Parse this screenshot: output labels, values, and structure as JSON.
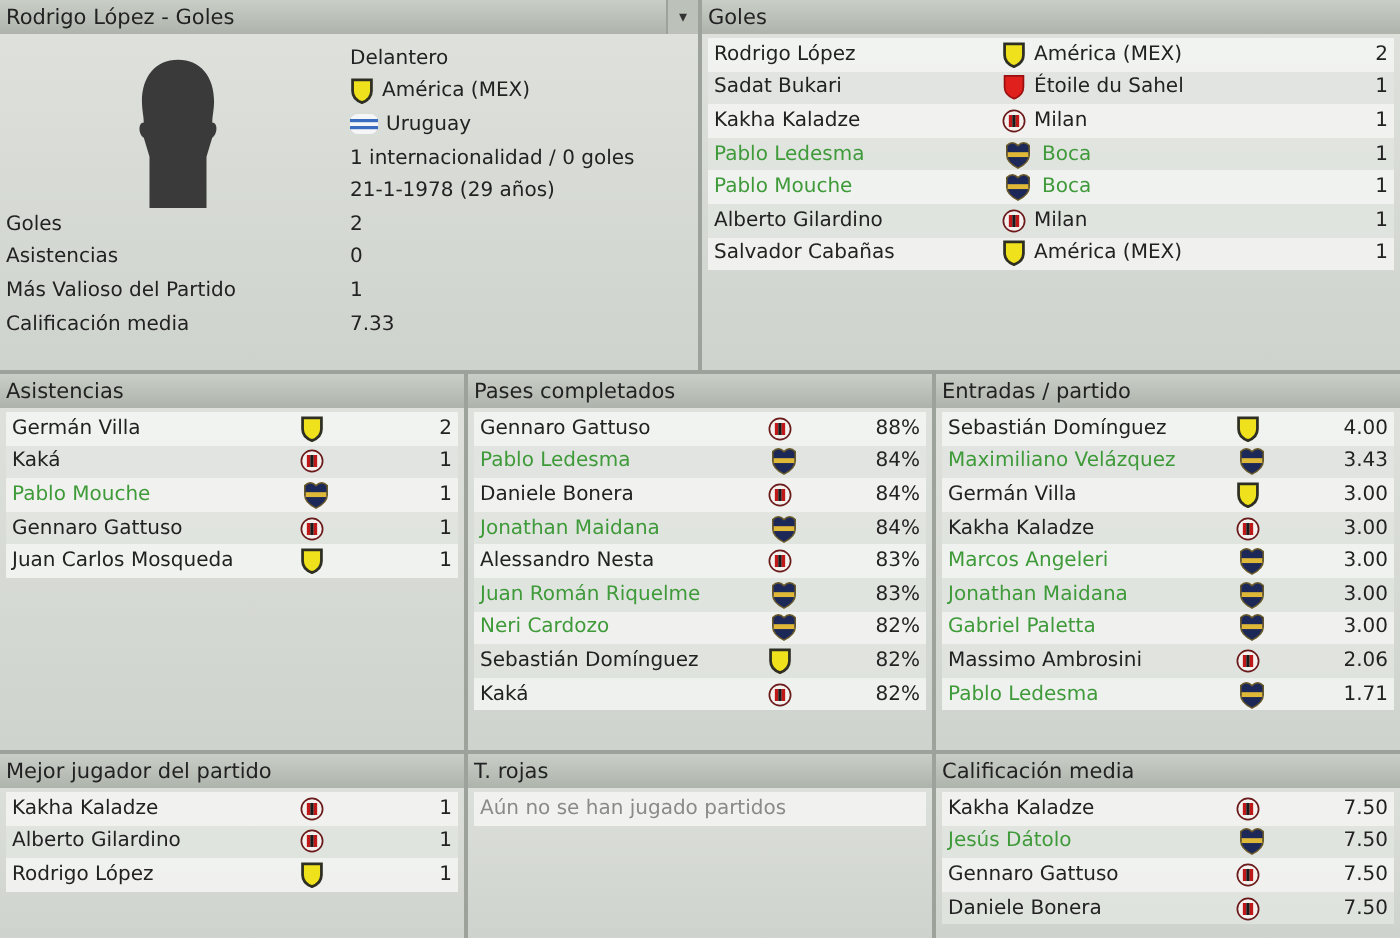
{
  "profile": {
    "title": "Rodrigo López - Goles",
    "menu_glyph": "▾",
    "position": "Delantero",
    "club": {
      "name": "América (MEX)",
      "kind": "america"
    },
    "nation": "Uruguay",
    "caps": "1 internacionalidad / 0 goles",
    "birth": "21-1-1978 (29 años)",
    "stats": [
      {
        "label": "Goles",
        "value": "2"
      },
      {
        "label": "Asistencias",
        "value": "0"
      },
      {
        "label": "Más Valioso del Partido",
        "value": "1"
      },
      {
        "label": "Calificación media",
        "value": "7.33"
      }
    ]
  },
  "goals": {
    "title": "Goles",
    "rows": [
      {
        "name": "Rodrigo López",
        "kind": "america",
        "team": "América (MEX)",
        "own": false,
        "value": "2"
      },
      {
        "name": "Sadat Bukari",
        "kind": "etoile",
        "team": "Étoile du Sahel",
        "own": false,
        "value": "1"
      },
      {
        "name": "Kakha Kaladze",
        "kind": "milan",
        "team": "Milan",
        "own": false,
        "value": "1"
      },
      {
        "name": "Pablo Ledesma",
        "kind": "boca",
        "team": "Boca",
        "own": true,
        "value": "1"
      },
      {
        "name": "Pablo Mouche",
        "kind": "boca",
        "team": "Boca",
        "own": true,
        "value": "1"
      },
      {
        "name": "Alberto Gilardino",
        "kind": "milan",
        "team": "Milan",
        "own": false,
        "value": "1"
      },
      {
        "name": "Salvador Cabañas",
        "kind": "america",
        "team": "América (MEX)",
        "own": false,
        "value": "1"
      }
    ]
  },
  "panels": [
    {
      "title": "Asistencias",
      "rows": [
        {
          "name": "Germán Villa",
          "kind": "america",
          "own": false,
          "value": "2"
        },
        {
          "name": "Kaká",
          "kind": "milan",
          "own": false,
          "value": "1"
        },
        {
          "name": "Pablo Mouche",
          "kind": "boca",
          "own": true,
          "value": "1"
        },
        {
          "name": "Gennaro Gattuso",
          "kind": "milan",
          "own": false,
          "value": "1"
        },
        {
          "name": "Juan Carlos Mosqueda",
          "kind": "america",
          "own": false,
          "value": "1"
        }
      ]
    },
    {
      "title": "Pases completados",
      "rows": [
        {
          "name": "Gennaro Gattuso",
          "kind": "milan",
          "own": false,
          "value": "88%"
        },
        {
          "name": "Pablo Ledesma",
          "kind": "boca",
          "own": true,
          "value": "84%"
        },
        {
          "name": "Daniele Bonera",
          "kind": "milan",
          "own": false,
          "value": "84%"
        },
        {
          "name": "Jonathan Maidana",
          "kind": "boca",
          "own": true,
          "value": "84%"
        },
        {
          "name": "Alessandro Nesta",
          "kind": "milan",
          "own": false,
          "value": "83%"
        },
        {
          "name": "Juan Román Riquelme",
          "kind": "boca",
          "own": true,
          "value": "83%"
        },
        {
          "name": "Neri Cardozo",
          "kind": "boca",
          "own": true,
          "value": "82%"
        },
        {
          "name": "Sebastián Domínguez",
          "kind": "america",
          "own": false,
          "value": "82%"
        },
        {
          "name": "Kaká",
          "kind": "milan",
          "own": false,
          "value": "82%"
        }
      ]
    },
    {
      "title": "Entradas / partido",
      "rows": [
        {
          "name": "Sebastián Domínguez",
          "kind": "america",
          "own": false,
          "value": "4.00"
        },
        {
          "name": "Maximiliano Velázquez",
          "kind": "boca",
          "own": true,
          "value": "3.43"
        },
        {
          "name": "Germán Villa",
          "kind": "america",
          "own": false,
          "value": "3.00"
        },
        {
          "name": "Kakha Kaladze",
          "kind": "milan",
          "own": false,
          "value": "3.00"
        },
        {
          "name": "Marcos Angeleri",
          "kind": "boca",
          "own": true,
          "value": "3.00"
        },
        {
          "name": "Jonathan Maidana",
          "kind": "boca",
          "own": true,
          "value": "3.00"
        },
        {
          "name": "Gabriel Paletta",
          "kind": "boca",
          "own": true,
          "value": "3.00"
        },
        {
          "name": "Massimo Ambrosini",
          "kind": "milan",
          "own": false,
          "value": "2.06"
        },
        {
          "name": "Pablo Ledesma",
          "kind": "boca",
          "own": true,
          "value": "1.71"
        }
      ]
    },
    {
      "title": "Mejor jugador del partido",
      "rows": [
        {
          "name": "Kakha Kaladze",
          "kind": "milan",
          "own": false,
          "value": "1"
        },
        {
          "name": "Alberto Gilardino",
          "kind": "milan",
          "own": false,
          "value": "1"
        },
        {
          "name": "Rodrigo López",
          "kind": "america",
          "own": false,
          "value": "1"
        }
      ]
    },
    {
      "title": "T. rojas",
      "empty": "Aún no se han jugado partidos"
    },
    {
      "title": "Calificación media",
      "rows": [
        {
          "name": "Kakha Kaladze",
          "kind": "milan",
          "own": false,
          "value": "7.50"
        },
        {
          "name": "Jesús Dátolo",
          "kind": "boca",
          "own": true,
          "value": "7.50"
        },
        {
          "name": "Gennaro Gattuso",
          "kind": "milan",
          "own": false,
          "value": "7.50"
        },
        {
          "name": "Daniele Bonera",
          "kind": "milan",
          "own": false,
          "value": "7.50"
        }
      ]
    }
  ]
}
